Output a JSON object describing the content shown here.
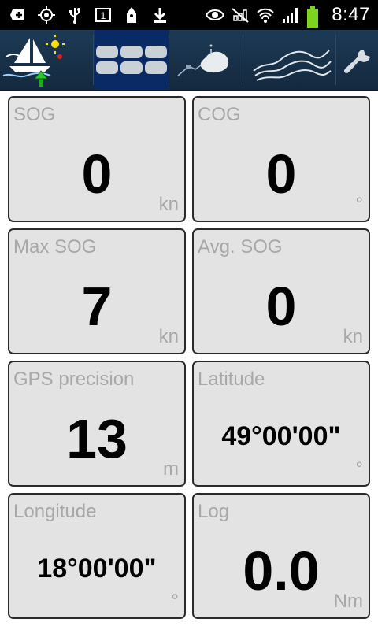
{
  "status_bar": {
    "time": "8:47",
    "icons": [
      "plus-notification-icon",
      "gps-icon",
      "usb-icon",
      "sim-icon",
      "boat-notification-icon",
      "download-icon",
      "eye-icon",
      "signal-mute-icon",
      "wifi-icon",
      "cell-signal-icon",
      "battery-icon"
    ]
  },
  "toolbar": {
    "buttons": [
      "sailboat-logo",
      "dashboard",
      "map",
      "track",
      "settings"
    ]
  },
  "tiles": [
    {
      "label": "SOG",
      "value": "0",
      "unit": "kn"
    },
    {
      "label": "COG",
      "value": "0",
      "unit": "°"
    },
    {
      "label": "Max SOG",
      "value": "7",
      "unit": "kn"
    },
    {
      "label": "Avg. SOG",
      "value": "0",
      "unit": "kn"
    },
    {
      "label": "GPS precision",
      "value": "13",
      "unit": "m"
    },
    {
      "label": "Latitude",
      "value": "49°00'00\"",
      "unit": "°"
    },
    {
      "label": "Longitude",
      "value": "18°00'00\"",
      "unit": "°"
    },
    {
      "label": "Log",
      "value": "0.0",
      "unit": "Nm"
    }
  ],
  "colors": {
    "toolbar_bg": "#1a3550",
    "active_tab": "#0a2a66",
    "tile_bg": "#e3e3e3",
    "label_gray": "#a8a8a8"
  }
}
